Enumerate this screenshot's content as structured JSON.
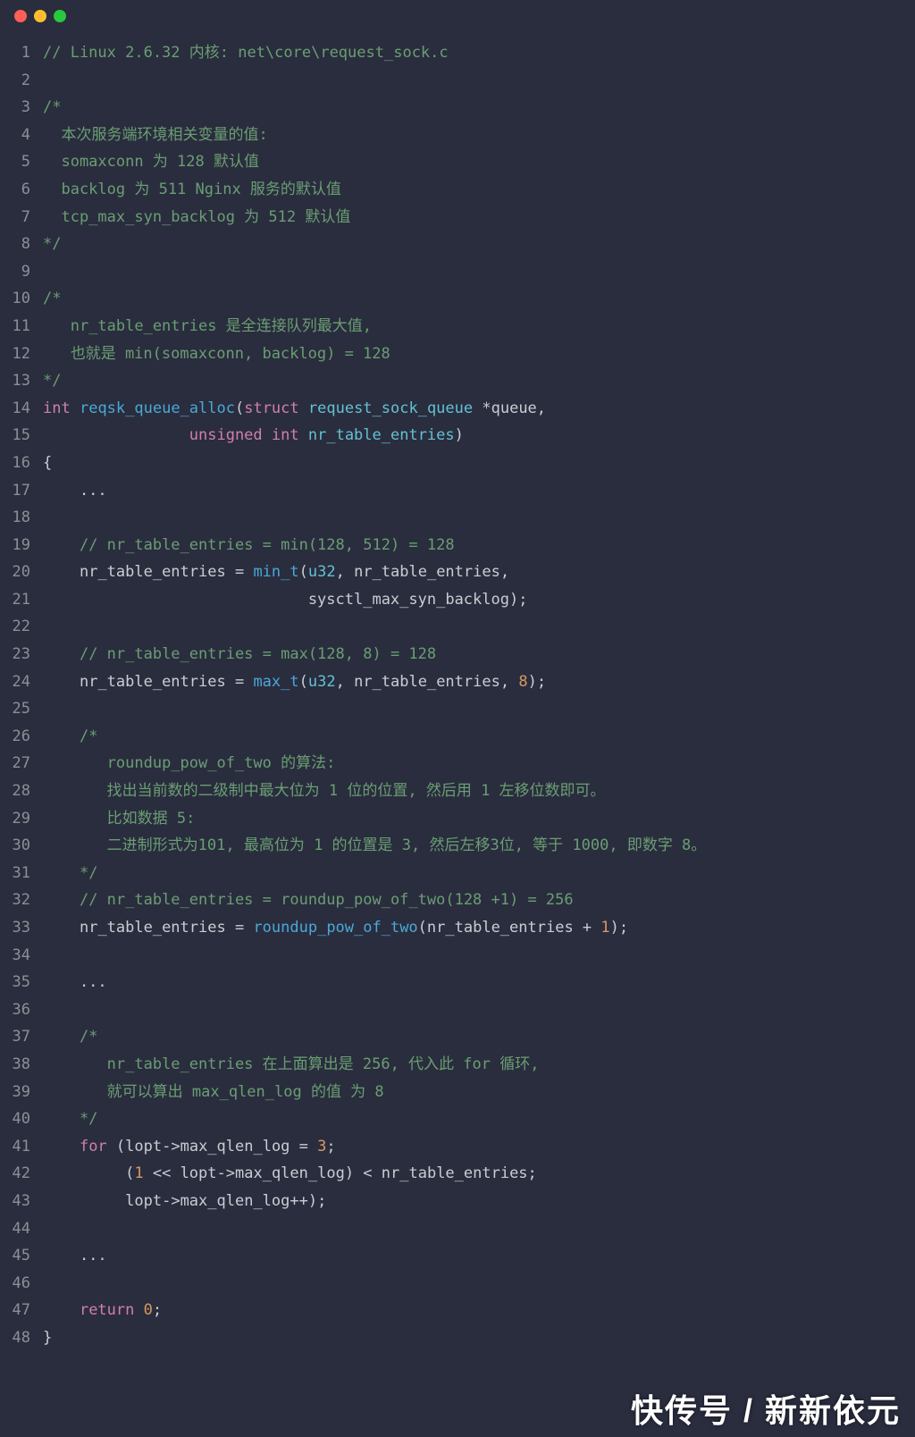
{
  "colors": {
    "bg": "#2a2d3e",
    "gutter": "#8a9097",
    "text": "#c9cdd3",
    "comment": "#6a9e73",
    "keyword": "#d07fb0",
    "type": "#62c1d2",
    "func": "#4aa8d8",
    "number": "#d8985f",
    "tl_close": "#ff5f56",
    "tl_min": "#ffbd2e",
    "tl_max": "#27c93f"
  },
  "watermark": "快传号 / 新新依元",
  "code": {
    "line_count": 48,
    "lines": [
      [
        {
          "t": "comment",
          "v": "// Linux 2.6.32 内核: net\\core\\request_sock.c"
        }
      ],
      [],
      [
        {
          "t": "comment",
          "v": "/*"
        }
      ],
      [
        {
          "t": "comment",
          "v": "  本次服务端环境相关变量的值:"
        }
      ],
      [
        {
          "t": "comment",
          "v": "  somaxconn 为 128 默认值"
        }
      ],
      [
        {
          "t": "comment",
          "v": "  backlog 为 511 Nginx 服务的默认值"
        }
      ],
      [
        {
          "t": "comment",
          "v": "  tcp_max_syn_backlog 为 512 默认值"
        }
      ],
      [
        {
          "t": "comment",
          "v": "*/"
        }
      ],
      [],
      [
        {
          "t": "comment",
          "v": "/*"
        }
      ],
      [
        {
          "t": "comment",
          "v": "   nr_table_entries 是全连接队列最大值,"
        }
      ],
      [
        {
          "t": "comment",
          "v": "   也就是 min(somaxconn, backlog) = 128"
        }
      ],
      [
        {
          "t": "comment",
          "v": "*/"
        }
      ],
      [
        {
          "t": "keyword",
          "v": "int"
        },
        {
          "t": "op",
          "v": " "
        },
        {
          "t": "func",
          "v": "reqsk_queue_alloc"
        },
        {
          "t": "op",
          "v": "("
        },
        {
          "t": "keyword",
          "v": "struct"
        },
        {
          "t": "op",
          "v": " "
        },
        {
          "t": "type",
          "v": "request_sock_queue"
        },
        {
          "t": "op",
          "v": " *"
        },
        {
          "t": "ident",
          "v": "queue"
        },
        {
          "t": "op",
          "v": ","
        }
      ],
      [
        {
          "t": "op",
          "v": "                "
        },
        {
          "t": "keyword",
          "v": "unsigned"
        },
        {
          "t": "op",
          "v": " "
        },
        {
          "t": "keyword",
          "v": "int"
        },
        {
          "t": "op",
          "v": " "
        },
        {
          "t": "type",
          "v": "nr_table_entries"
        },
        {
          "t": "op",
          "v": ")"
        }
      ],
      [
        {
          "t": "op",
          "v": "{"
        }
      ],
      [
        {
          "t": "op",
          "v": "    ..."
        }
      ],
      [],
      [
        {
          "t": "op",
          "v": "    "
        },
        {
          "t": "comment",
          "v": "// nr_table_entries = min(128, 512) = 128"
        }
      ],
      [
        {
          "t": "op",
          "v": "    "
        },
        {
          "t": "ident",
          "v": "nr_table_entries"
        },
        {
          "t": "op",
          "v": " = "
        },
        {
          "t": "func",
          "v": "min_t"
        },
        {
          "t": "op",
          "v": "("
        },
        {
          "t": "type",
          "v": "u32"
        },
        {
          "t": "op",
          "v": ", "
        },
        {
          "t": "ident",
          "v": "nr_table_entries"
        },
        {
          "t": "op",
          "v": ","
        }
      ],
      [
        {
          "t": "op",
          "v": "                             "
        },
        {
          "t": "ident",
          "v": "sysctl_max_syn_backlog"
        },
        {
          "t": "op",
          "v": ");"
        }
      ],
      [],
      [
        {
          "t": "op",
          "v": "    "
        },
        {
          "t": "comment",
          "v": "// nr_table_entries = max(128, 8) = 128"
        }
      ],
      [
        {
          "t": "op",
          "v": "    "
        },
        {
          "t": "ident",
          "v": "nr_table_entries"
        },
        {
          "t": "op",
          "v": " = "
        },
        {
          "t": "func",
          "v": "max_t"
        },
        {
          "t": "op",
          "v": "("
        },
        {
          "t": "type",
          "v": "u32"
        },
        {
          "t": "op",
          "v": ", "
        },
        {
          "t": "ident",
          "v": "nr_table_entries"
        },
        {
          "t": "op",
          "v": ", "
        },
        {
          "t": "num",
          "v": "8"
        },
        {
          "t": "op",
          "v": ");"
        }
      ],
      [],
      [
        {
          "t": "op",
          "v": "    "
        },
        {
          "t": "comment",
          "v": "/*"
        }
      ],
      [
        {
          "t": "op",
          "v": "    "
        },
        {
          "t": "comment",
          "v": "   roundup_pow_of_two 的算法:"
        }
      ],
      [
        {
          "t": "op",
          "v": "    "
        },
        {
          "t": "comment",
          "v": "   找出当前数的二级制中最大位为 1 位的位置, 然后用 1 左移位数即可。"
        }
      ],
      [
        {
          "t": "op",
          "v": "    "
        },
        {
          "t": "comment",
          "v": "   比如数据 5:"
        }
      ],
      [
        {
          "t": "op",
          "v": "    "
        },
        {
          "t": "comment",
          "v": "   二进制形式为101, 最高位为 1 的位置是 3, 然后左移3位, 等于 1000, 即数字 8。"
        }
      ],
      [
        {
          "t": "op",
          "v": "    "
        },
        {
          "t": "comment",
          "v": "*/"
        }
      ],
      [
        {
          "t": "op",
          "v": "    "
        },
        {
          "t": "comment",
          "v": "// nr_table_entries = roundup_pow_of_two(128 +1) = 256"
        }
      ],
      [
        {
          "t": "op",
          "v": "    "
        },
        {
          "t": "ident",
          "v": "nr_table_entries"
        },
        {
          "t": "op",
          "v": " = "
        },
        {
          "t": "func",
          "v": "roundup_pow_of_two"
        },
        {
          "t": "op",
          "v": "("
        },
        {
          "t": "ident",
          "v": "nr_table_entries"
        },
        {
          "t": "op",
          "v": " + "
        },
        {
          "t": "num",
          "v": "1"
        },
        {
          "t": "op",
          "v": ");"
        }
      ],
      [],
      [
        {
          "t": "op",
          "v": "    ..."
        }
      ],
      [],
      [
        {
          "t": "op",
          "v": "    "
        },
        {
          "t": "comment",
          "v": "/*"
        }
      ],
      [
        {
          "t": "op",
          "v": "    "
        },
        {
          "t": "comment",
          "v": "   nr_table_entries 在上面算出是 256, 代入此 for 循环,"
        }
      ],
      [
        {
          "t": "op",
          "v": "    "
        },
        {
          "t": "comment",
          "v": "   就可以算出 max_qlen_log 的值 为 8"
        }
      ],
      [
        {
          "t": "op",
          "v": "    "
        },
        {
          "t": "comment",
          "v": "*/"
        }
      ],
      [
        {
          "t": "op",
          "v": "    "
        },
        {
          "t": "keyword",
          "v": "for"
        },
        {
          "t": "op",
          "v": " ("
        },
        {
          "t": "ident",
          "v": "lopt"
        },
        {
          "t": "arrow",
          "v": "->"
        },
        {
          "t": "ident",
          "v": "max_qlen_log"
        },
        {
          "t": "op",
          "v": " = "
        },
        {
          "t": "num",
          "v": "3"
        },
        {
          "t": "op",
          "v": ";"
        }
      ],
      [
        {
          "t": "op",
          "v": "         ("
        },
        {
          "t": "num",
          "v": "1"
        },
        {
          "t": "op",
          "v": " << "
        },
        {
          "t": "ident",
          "v": "lopt"
        },
        {
          "t": "arrow",
          "v": "->"
        },
        {
          "t": "ident",
          "v": "max_qlen_log"
        },
        {
          "t": "op",
          "v": ") < "
        },
        {
          "t": "ident",
          "v": "nr_table_entries"
        },
        {
          "t": "op",
          "v": ";"
        }
      ],
      [
        {
          "t": "op",
          "v": "         "
        },
        {
          "t": "ident",
          "v": "lopt"
        },
        {
          "t": "arrow",
          "v": "->"
        },
        {
          "t": "ident",
          "v": "max_qlen_log"
        },
        {
          "t": "op",
          "v": "++);"
        }
      ],
      [],
      [
        {
          "t": "op",
          "v": "    ..."
        }
      ],
      [],
      [
        {
          "t": "op",
          "v": "    "
        },
        {
          "t": "keyword",
          "v": "return"
        },
        {
          "t": "op",
          "v": " "
        },
        {
          "t": "num",
          "v": "0"
        },
        {
          "t": "op",
          "v": ";"
        }
      ],
      [
        {
          "t": "op",
          "v": "}"
        }
      ]
    ]
  }
}
